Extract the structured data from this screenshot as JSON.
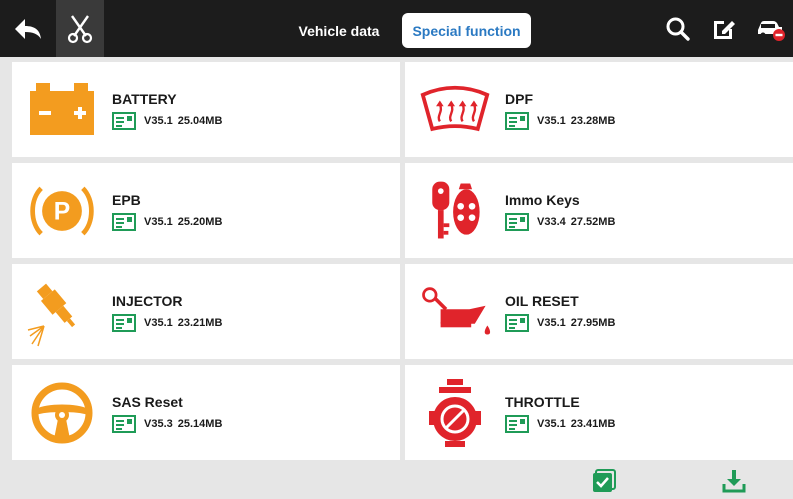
{
  "topbar": {
    "back_icon": "back-arrow-icon",
    "cut_icon": "scissors-icon",
    "tabs": [
      {
        "label": "Vehicle data",
        "active": false
      },
      {
        "label": "Special function",
        "active": true
      }
    ],
    "search_icon": "search-icon",
    "edit_icon": "edit-icon",
    "car_icon": "car-disconnect-icon"
  },
  "functions": [
    {
      "title": "BATTERY",
      "version": "V35.1",
      "size": "25.04MB",
      "icon": "battery-icon"
    },
    {
      "title": "DPF",
      "version": "V35.1",
      "size": "23.28MB",
      "icon": "dpf-icon"
    },
    {
      "title": "EPB",
      "version": "V35.1",
      "size": "25.20MB",
      "icon": "parking-brake-icon"
    },
    {
      "title": "Immo Keys",
      "version": "V33.4",
      "size": "27.52MB",
      "icon": "key-fob-icon"
    },
    {
      "title": "INJECTOR",
      "version": "V35.1",
      "size": "23.21MB",
      "icon": "injector-icon"
    },
    {
      "title": "OIL RESET",
      "version": "V35.1",
      "size": "27.95MB",
      "icon": "oil-can-icon"
    },
    {
      "title": "SAS Reset",
      "version": "V35.3",
      "size": "25.14MB",
      "icon": "steering-wheel-icon"
    },
    {
      "title": "THROTTLE",
      "version": "V35.1",
      "size": "23.41MB",
      "icon": "throttle-icon"
    }
  ],
  "bottombar": {
    "select_icon": "checkbox-icon",
    "download_icon": "download-icon"
  },
  "colors": {
    "topbar": "#1c1c1c",
    "accent_orange": "#f39c1f",
    "accent_red": "#e0242b",
    "accent_green": "#1f9b57",
    "tab_blue": "#2a79c2"
  }
}
